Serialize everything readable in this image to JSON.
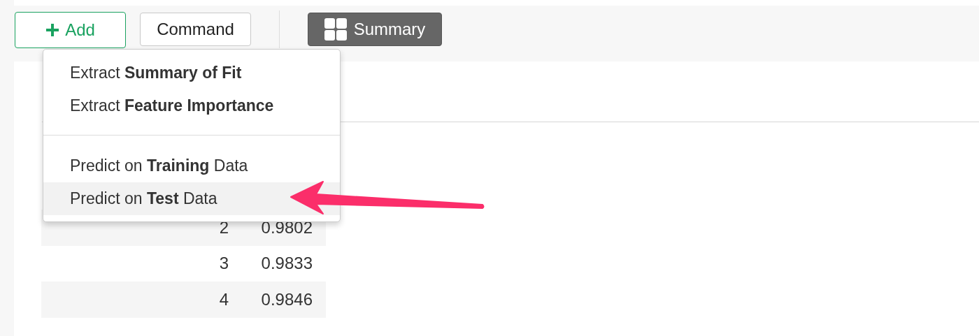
{
  "toolbar": {
    "add_button": "Add",
    "command_button": "Command",
    "views": [
      {
        "label": "Summary",
        "selected": true
      }
    ]
  },
  "menu": {
    "groups": [
      [
        {
          "label": "Extract **Summary of Fit**",
          "selected": false
        },
        {
          "label": "Extract **Feature Importance**",
          "selected": false
        }
      ],
      [
        {
          "label": "Predict on **Training** Data",
          "selected": false
        },
        {
          "label": "Predict on **Test** Data",
          "selected": true
        }
      ]
    ]
  },
  "table": {
    "rows": [
      {
        "column_1": "2",
        "column_2": "0.9802"
      },
      {
        "column_1": "3",
        "column_2": "0.9833"
      },
      {
        "column_1": "4",
        "column_2": "0.9846"
      }
    ]
  }
}
